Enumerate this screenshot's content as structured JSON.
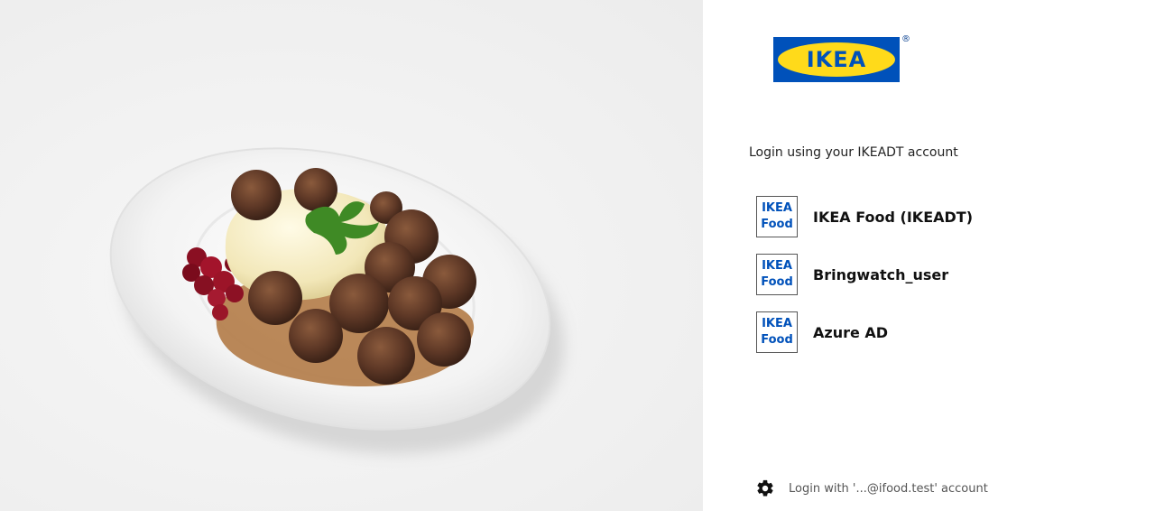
{
  "colors": {
    "brand_blue": "#0051ba",
    "brand_yellow": "#ffda1a"
  },
  "brand": {
    "wordmark": "IKEA",
    "registered": "®"
  },
  "login": {
    "prompt": "Login using your IKEADT account",
    "provider_badge": {
      "line1": "IKEA",
      "line2": "Food"
    },
    "providers": [
      {
        "label": "IKEA Food (IKEADT)",
        "icon": "ikea-food-logo"
      },
      {
        "label": "Bringwatch_user",
        "icon": "ikea-food-logo"
      },
      {
        "label": "Azure AD",
        "icon": "ikea-food-logo"
      }
    ],
    "alt_login": {
      "label": "Login with '...@ifood.test' account",
      "icon": "gear-icon"
    }
  },
  "hero": {
    "image": "plate of meatballs with mashed potatoes, gravy and lingonberries"
  }
}
